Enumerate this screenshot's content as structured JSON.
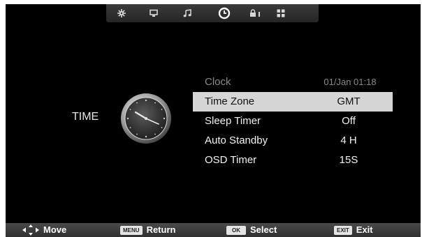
{
  "top_menu": {
    "icons": [
      "picture-settings-icon",
      "monitor-icon",
      "music-note-icon",
      "clock-icon",
      "lock-icon",
      "apps-grid-icon"
    ],
    "active": "clock-icon"
  },
  "menu": {
    "title": "TIME",
    "items": [
      {
        "label": "Clock",
        "value": "01/Jan 01:18",
        "state": "disabled"
      },
      {
        "label": "Time Zone",
        "value": "GMT",
        "state": "selected"
      },
      {
        "label": "Sleep Timer",
        "value": "Off",
        "state": "normal"
      },
      {
        "label": "Auto Standby",
        "value": "4 H",
        "state": "normal"
      },
      {
        "label": "OSD Timer",
        "value": "15S",
        "state": "normal"
      }
    ]
  },
  "hints": {
    "move": "Move",
    "menu_key": "MENU",
    "return": "Return",
    "ok_key": "OK",
    "select": "Select",
    "exit_key": "EXIT",
    "exit": "Exit"
  },
  "colors": {
    "background": "#000000",
    "selection": "#d6d6d6",
    "text": "#f2f2f2",
    "disabled_text": "#8a8a8a"
  }
}
